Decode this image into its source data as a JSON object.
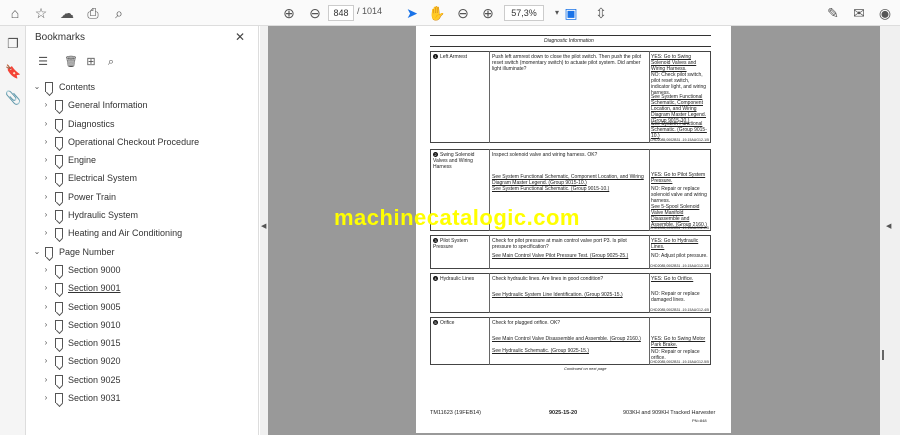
{
  "toolbar": {
    "page_current": "848",
    "page_separator": "/",
    "page_total": "1014",
    "zoom_value": "57,3%"
  },
  "bookmarks": {
    "title": "Bookmarks",
    "items": [
      {
        "label": "Contents"
      },
      {
        "label": "General Information"
      },
      {
        "label": "Diagnostics"
      },
      {
        "label": "Operational Checkout Procedure"
      },
      {
        "label": "Engine"
      },
      {
        "label": "Electrical System"
      },
      {
        "label": "Power Train"
      },
      {
        "label": "Hydraulic System"
      },
      {
        "label": "Heating and Air Conditioning"
      },
      {
        "label": "Page Number"
      },
      {
        "label": "Section 9000"
      },
      {
        "label": "Section 9001"
      },
      {
        "label": "Section 9005"
      },
      {
        "label": "Section 9010"
      },
      {
        "label": "Section 9015"
      },
      {
        "label": "Section 9020"
      },
      {
        "label": "Section 9025"
      },
      {
        "label": "Section 9031"
      }
    ]
  },
  "document": {
    "header": "Diagnostic Information",
    "watermark": "machinecatalogic.com",
    "rows": [
      {
        "num": "1",
        "name": "Left Armrest",
        "check": "Push left armrest down to close the pilot switch. Then push the pilot reset switch (momentary switch) to actuate pilot system. Did amber light illuminate?",
        "yes": "YES: Go to Swing Solenoid Valves and Wiring Harness.",
        "no": "NO: Check pilot switch, pilot reset switch, indicator light, and wiring harness.",
        "ref1": "See System Functional Schematic, Component Location, and Wiring Diagram Master Legend. (Group 9015-10.)",
        "ref2": "See System Functional Schematic. (Group 9015-10.)",
        "code": "CHD2085,0002B31 -19-15AUG12-1/5"
      },
      {
        "num": "2",
        "name": "Swing Solenoid Valves and Wiring Harness",
        "check": "Inspect solenoid valve and wiring harness. OK?",
        "ref1": "See System Functional Schematic, Component Location, and Wiring Diagram Master Legend. (Group 9015-10.)",
        "ref2": "See System Functional Schematic. (Group 9015-10.)",
        "yes": "YES: Go to Pilot System Pressure.",
        "no": "NO: Repair or replace solenoid valve and wiring harness.",
        "ref3": "See 5-Spool Solenoid Valve Manifold Disassemble and Assemble. (Group 2160.)",
        "code": "CHD2085,0002B31 -19-15AUG12-2/5"
      },
      {
        "num": "3",
        "name": "Pilot System Pressure",
        "check": "Check for pilot pressure at main control valve port P3. Is pilot pressure to specification?",
        "ref1": "See Main Control Valve Pilot Pressure Test. (Group 9025-25.)",
        "yes": "YES: Go to Hydraulic Lines.",
        "no": "NO: Adjust pilot pressure.",
        "code": "CHD2085,0002B31 -19-15AUG12-3/5"
      },
      {
        "num": "4",
        "name": "Hydraulic Lines",
        "check": "Check hydraulic lines. Are lines in good condition?",
        "ref1": "See Hydraulic System Line Identification. (Group 9025-15.)",
        "yes": "YES: Go to Orifice.",
        "no": "NO: Repair or replace damaged lines.",
        "code": "CHD2085,0002B31 -19-15AUG12-4/5"
      },
      {
        "num": "5",
        "name": "Orifice",
        "check": "Check for plugged orifice. OK?",
        "ref1": "See Main Control Valve Disassemble and Assemble. (Group 2160.)",
        "ref2": "See Hydraulic Schematic. (Group 9025-15.)",
        "yes": "YES: Go to Swing Motor Park Brake.",
        "no": "NO: Repair or replace orifice.",
        "code": "CHD2085,0002B31 -19-15AUG12-5/5"
      }
    ],
    "continued": "Continued on next page",
    "footer_left": "TM11623 (19FEB14)",
    "footer_center": "9025-15-20",
    "footer_right": "903KH and 909KH Tracked Harvester",
    "footer_right2": "PN=848"
  }
}
